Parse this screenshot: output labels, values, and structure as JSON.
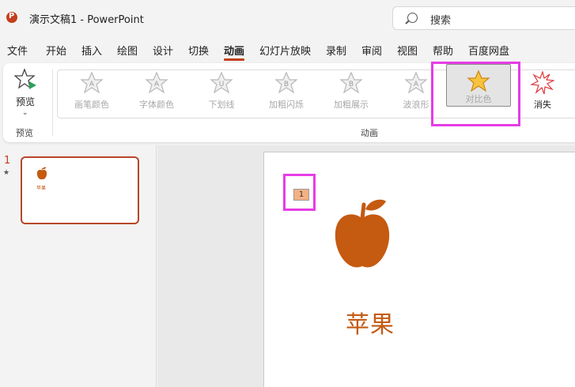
{
  "titlebar": {
    "document_name": "演示文稿1 - PowerPoint",
    "search_placeholder": "搜索"
  },
  "menu": {
    "tabs": [
      "文件",
      "开始",
      "插入",
      "绘图",
      "设计",
      "切换",
      "动画",
      "幻灯片放映",
      "录制",
      "审阅",
      "视图",
      "帮助",
      "百度网盘"
    ],
    "active": "动画"
  },
  "ribbon": {
    "preview": {
      "button_label": "预览",
      "group_label": "预览"
    },
    "animation_group_label": "动画",
    "effects": [
      {
        "label": "画笔颜色",
        "state": "disabled"
      },
      {
        "label": "字体颜色",
        "state": "disabled"
      },
      {
        "label": "下划线",
        "state": "disabled"
      },
      {
        "label": "加粗闪烁",
        "state": "disabled"
      },
      {
        "label": "加粗展示",
        "state": "disabled"
      },
      {
        "label": "波浪形",
        "state": "disabled"
      },
      {
        "label": "对比色",
        "state": "selected"
      },
      {
        "label": "消失",
        "state": "enabled"
      }
    ]
  },
  "thumbnails": {
    "slide_number": "1",
    "animation_marker": "★",
    "thumb_text": "苹果"
  },
  "slide": {
    "animation_order_tag": "1",
    "text": "苹果"
  },
  "colors": {
    "accent": "#c43e1c",
    "apple": "#c55a11",
    "highlight": "#e63ce6",
    "star_fill": "#f8c33c"
  },
  "icons": {
    "preview": "star-outline-play-icon",
    "emphasis": "star-letter-icon",
    "selected": "filled-star-icon",
    "exit": "burst-star-icon"
  }
}
